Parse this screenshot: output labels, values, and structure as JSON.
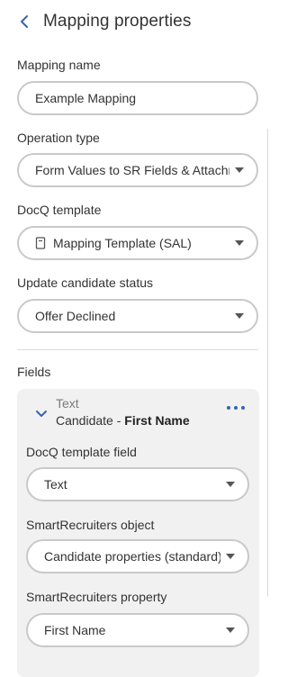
{
  "header": {
    "title": "Mapping properties",
    "back_icon": "chevron-left-icon"
  },
  "mapping_name": {
    "label": "Mapping name",
    "value": "Example Mapping"
  },
  "operation_type": {
    "label": "Operation type",
    "value": "Form Values to SR Fields & Attachments"
  },
  "docq_template": {
    "label": "DocQ template",
    "value": "Mapping Template (SAL)",
    "icon": "document-icon"
  },
  "candidate_status": {
    "label": "Update candidate status",
    "value": "Offer Declined"
  },
  "fields": {
    "label": "Fields",
    "card": {
      "type": "Text",
      "title_prefix": "Candidate - ",
      "title_bold": "First Name",
      "docq_field": {
        "label": "DocQ template field",
        "value": "Text"
      },
      "sr_object": {
        "label": "SmartRecruiters object",
        "value": "Candidate properties (standard)"
      },
      "sr_property": {
        "label": "SmartRecruiters property",
        "value": "First Name"
      }
    }
  },
  "colors": {
    "accent": "#3564b0",
    "border": "#c9c9c9",
    "card_bg": "#f1f1f1"
  }
}
